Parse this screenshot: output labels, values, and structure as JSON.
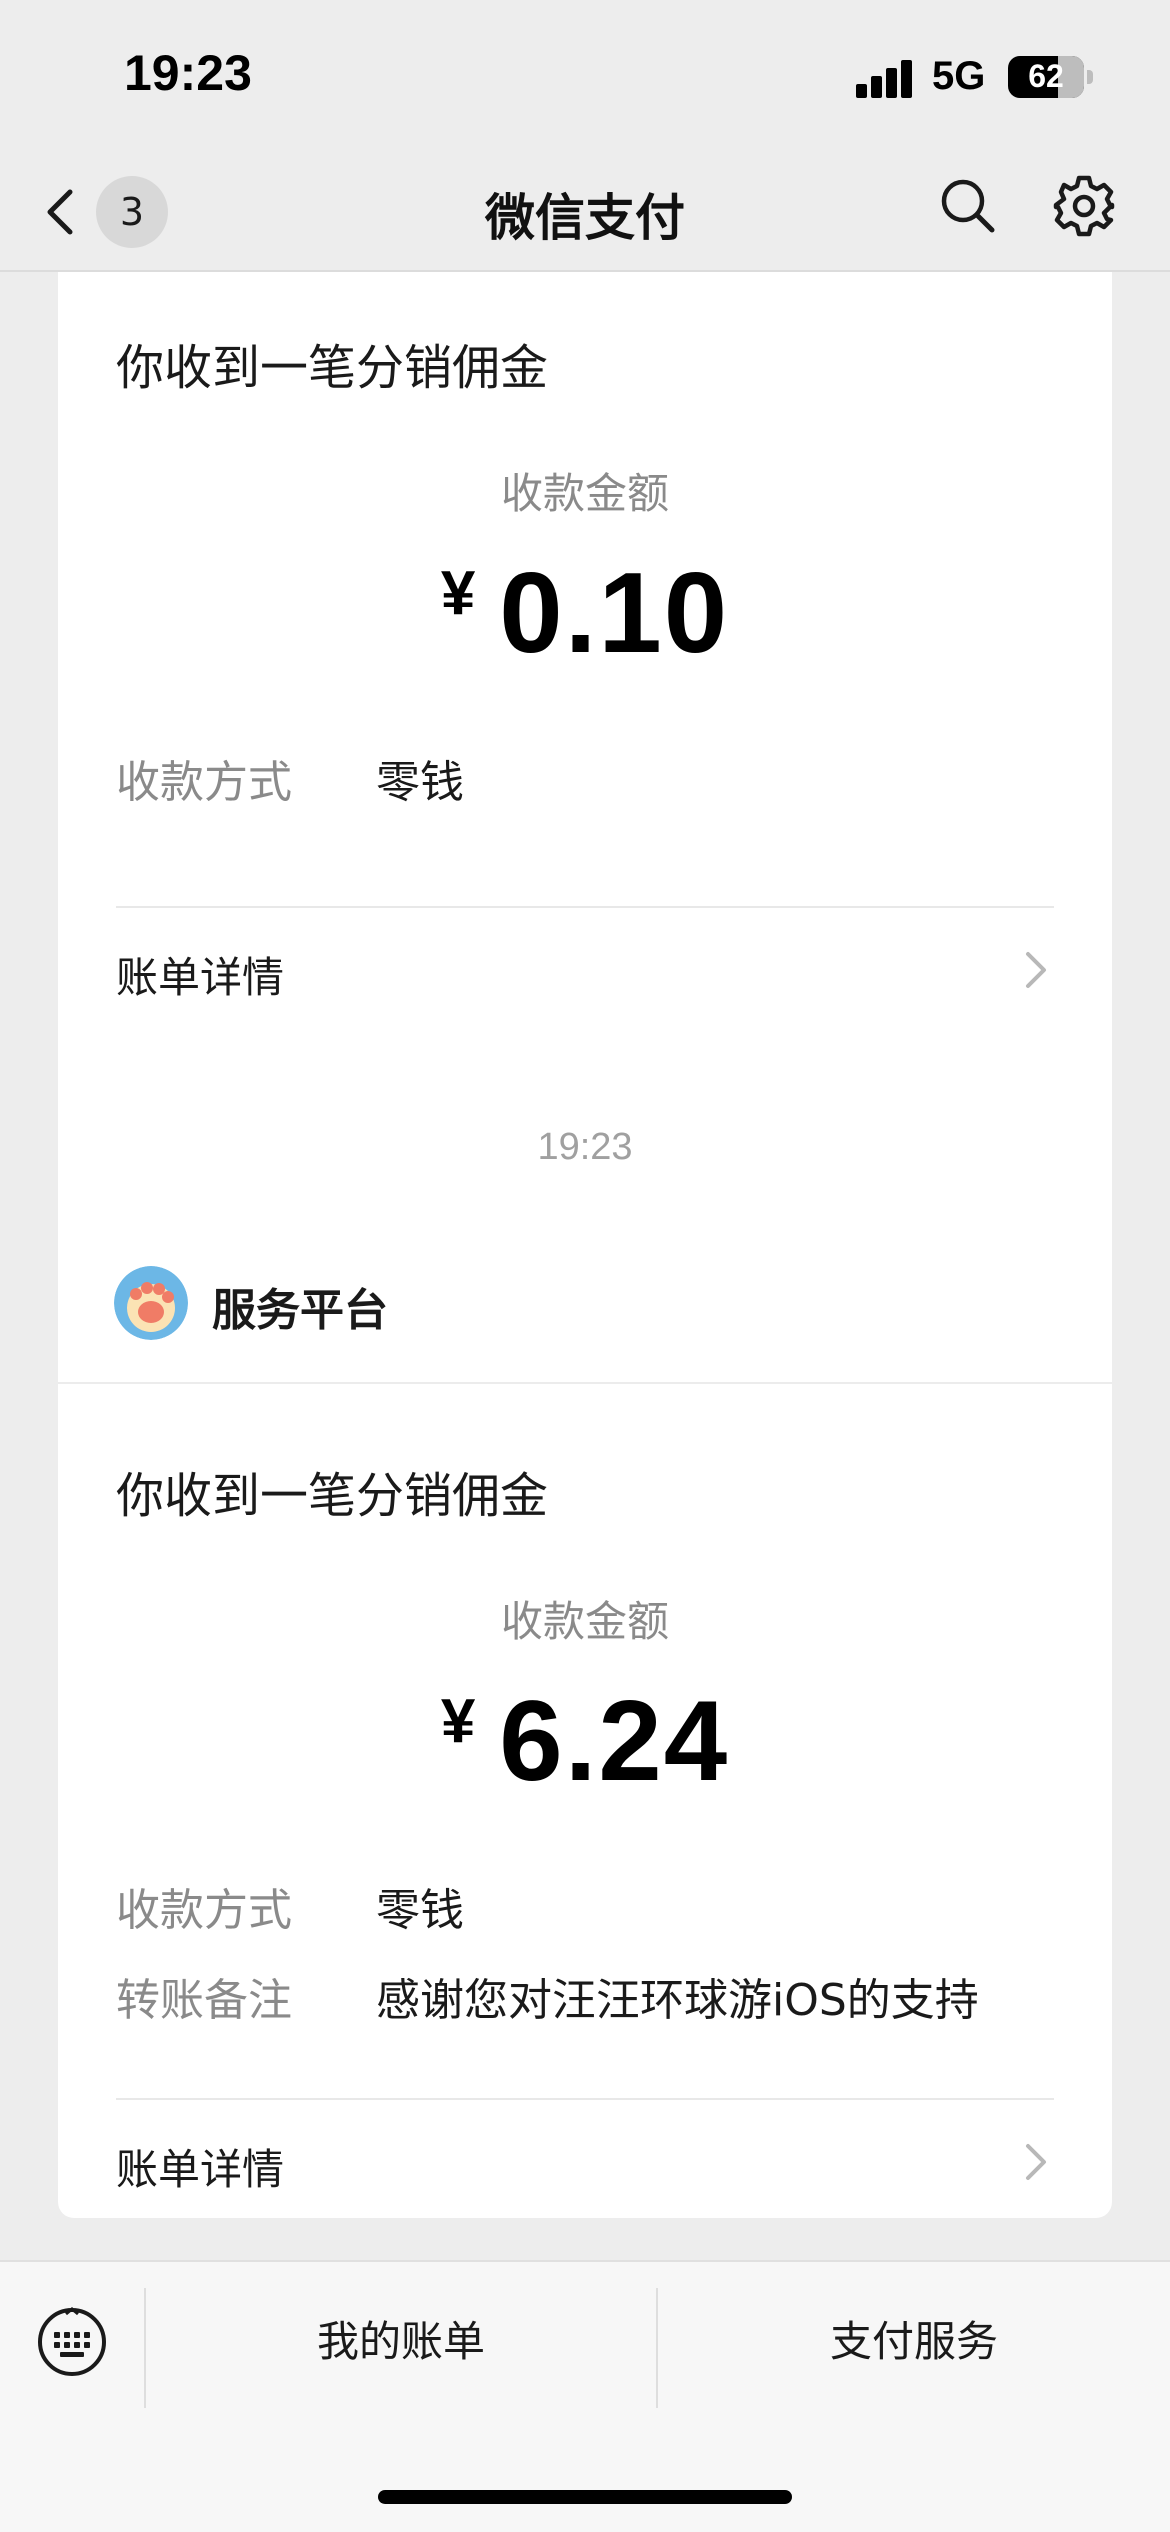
{
  "status_bar": {
    "time": "19:23",
    "network": "5G",
    "battery": "62"
  },
  "nav": {
    "back_badge": "3",
    "title": "微信支付"
  },
  "messages": [
    {
      "title": "你收到一笔分销佣金",
      "amount_label": "收款金额",
      "currency": "¥",
      "amount": "0.10",
      "rows": [
        {
          "label": "收款方式",
          "value": "零钱"
        }
      ],
      "detail_label": "账单详情"
    },
    {
      "timestamp": "19:23",
      "sender": "服务平台",
      "title": "你收到一笔分销佣金",
      "amount_label": "收款金额",
      "currency": "¥",
      "amount": "6.24",
      "rows": [
        {
          "label": "收款方式",
          "value": "零钱"
        },
        {
          "label": "转账备注",
          "value": "感谢您对汪汪环球游iOS的支持"
        }
      ],
      "detail_label": "账单详情"
    }
  ],
  "bottom_menu": {
    "bills": "我的账单",
    "services": "支付服务"
  },
  "colors": {
    "background": "#ededed",
    "card": "#ffffff",
    "muted_text": "#8a8a8a"
  }
}
